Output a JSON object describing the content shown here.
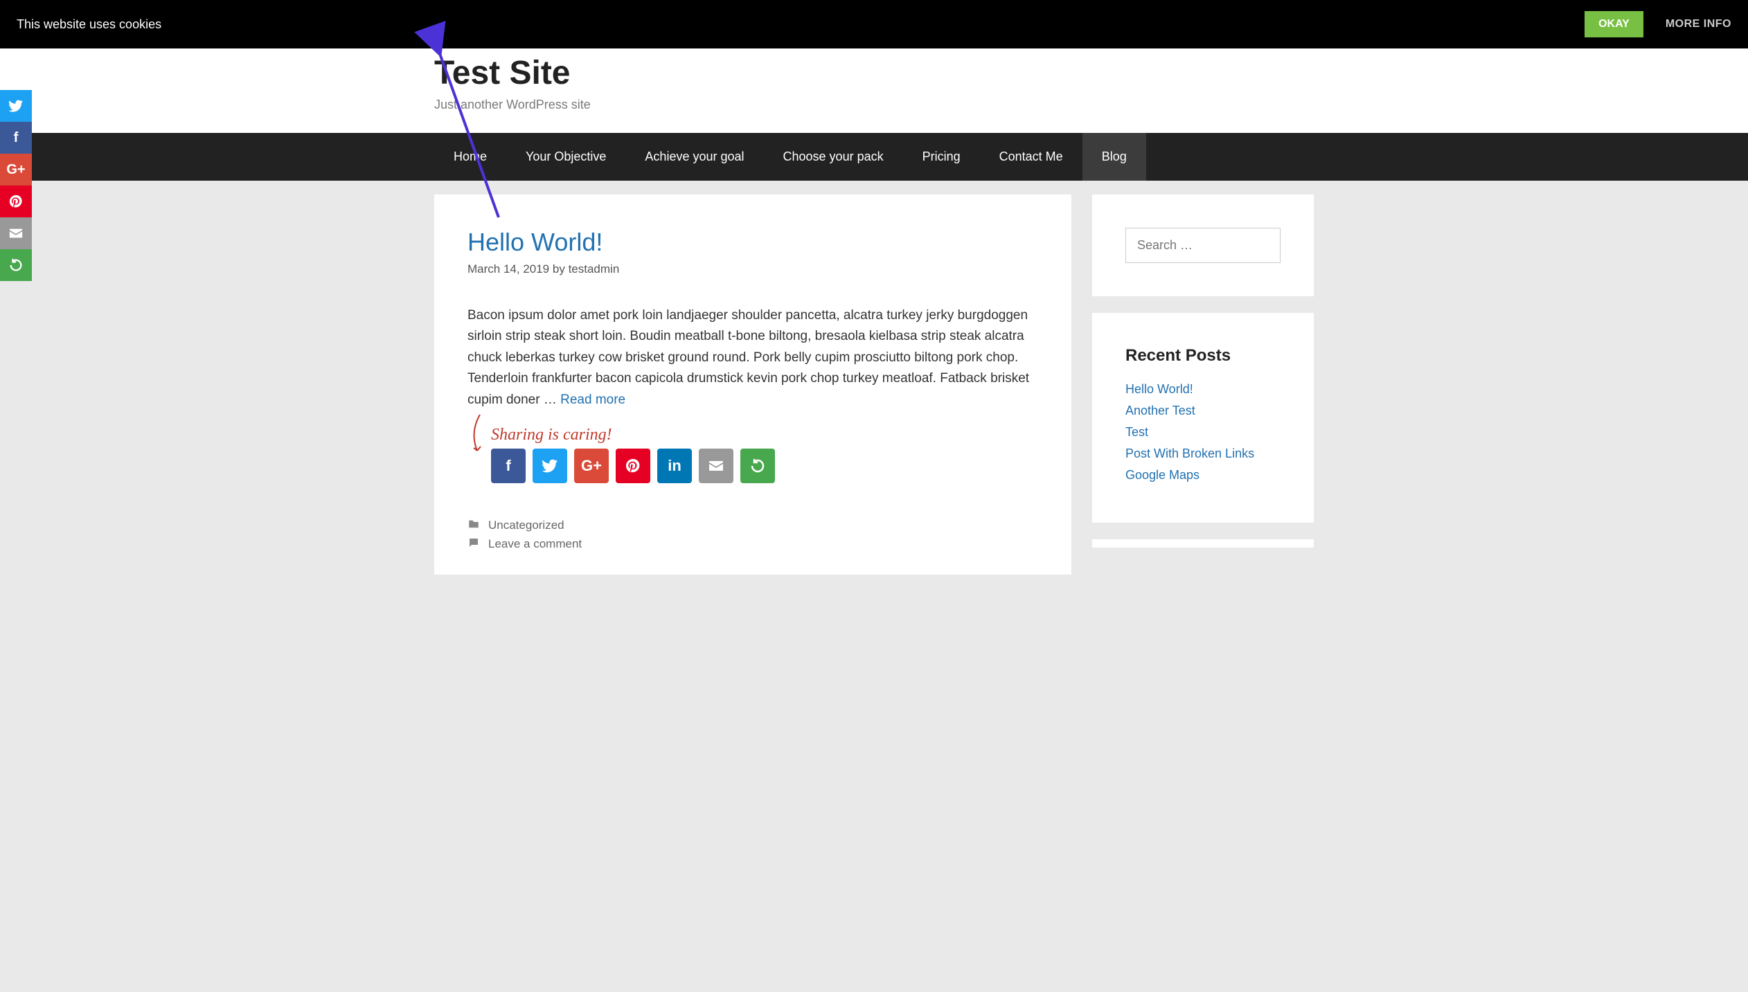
{
  "cookie": {
    "message": "This website uses cookies",
    "okay": "OKAY",
    "more_info": "MORE INFO"
  },
  "site": {
    "title": "Test Site",
    "tagline": "Just another WordPress site"
  },
  "nav": {
    "items": [
      {
        "label": "Home"
      },
      {
        "label": "Your Objective"
      },
      {
        "label": "Achieve your goal"
      },
      {
        "label": "Choose your pack"
      },
      {
        "label": "Pricing"
      },
      {
        "label": "Contact Me"
      },
      {
        "label": "Blog"
      }
    ],
    "active_index": 6
  },
  "post": {
    "title": "Hello World!",
    "date": "March 14, 2019",
    "byline_prefix": "by",
    "author": "testadmin",
    "excerpt": "Bacon ipsum dolor amet pork loin landjaeger shoulder pancetta, alcatra turkey jerky burgdoggen sirloin strip steak short loin. Boudin meatball t-bone biltong, bresaola kielbasa strip steak alcatra chuck leberkas turkey cow brisket ground round. Pork belly cupim prosciutto biltong pork chop. Tenderloin frankfurter bacon capicola drumstick kevin pork chop turkey meatloaf. Fatback brisket cupim doner … ",
    "read_more": "Read more",
    "share_caption": "Sharing is caring!",
    "category": "Uncategorized",
    "comment_link": "Leave a comment"
  },
  "share_icons": {
    "facebook": "f",
    "twitter": "twitter",
    "googleplus": "G+",
    "pinterest": "pinterest",
    "linkedin": "in",
    "email": "✉",
    "more": "↻"
  },
  "sidebar": {
    "search_placeholder": "Search …",
    "recent_title": "Recent Posts",
    "recent": [
      {
        "label": "Hello World!"
      },
      {
        "label": "Another Test"
      },
      {
        "label": "Test"
      },
      {
        "label": "Post With Broken Links"
      },
      {
        "label": "Google Maps"
      }
    ]
  },
  "colors": {
    "link": "#2271b1",
    "accent_green": "#77c043",
    "share_caption": "#c0392b",
    "annotation_arrow": "#4b32d6"
  }
}
